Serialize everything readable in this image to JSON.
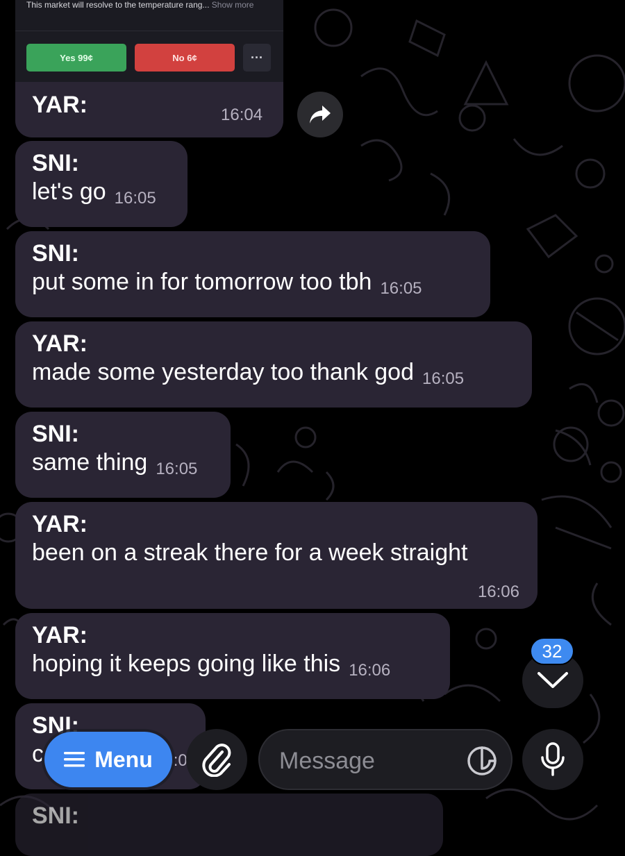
{
  "forwarded_card": {
    "description": "This market will resolve to the temperature rang...",
    "show_more": "Show more",
    "yes_label": "Yes 99¢",
    "no_label": "No 6¢",
    "more_label": "···",
    "sender": "YAR:",
    "time": "16:04"
  },
  "messages": [
    {
      "sender": "SNI:",
      "text": "let's go",
      "time": "16:05"
    },
    {
      "sender": "SNI:",
      "text": "put some in for tomorrow too tbh",
      "time": "16:05"
    },
    {
      "sender": "YAR:",
      "text": "made some yesterday too thank god",
      "time": "16:05"
    },
    {
      "sender": "SNI:",
      "text": "same thing",
      "time": "16:05"
    },
    {
      "sender": "YAR:",
      "text": "been on a streak there for a week straight",
      "time": "16:06"
    },
    {
      "sender": "YAR:",
      "text": "hoping it keeps going like this",
      "time": "16:06"
    },
    {
      "sender": "SNI:",
      "text": "c",
      "time": "16:06"
    },
    {
      "sender": "SNI:",
      "text": "",
      "time": ""
    }
  ],
  "unread_badge": "32",
  "bottom_bar": {
    "menu_label": "Menu",
    "message_placeholder": "Message"
  },
  "icons": {
    "forward": "forward-icon",
    "scroll_down": "chevron-down-icon",
    "menu": "hamburger-icon",
    "attach": "paperclip-icon",
    "sticker": "sticker-icon",
    "mic": "microphone-icon"
  },
  "colors": {
    "bubble": "#2a2534",
    "accent": "#3e8af0",
    "yes": "#3aa35a",
    "no": "#d2413f"
  }
}
